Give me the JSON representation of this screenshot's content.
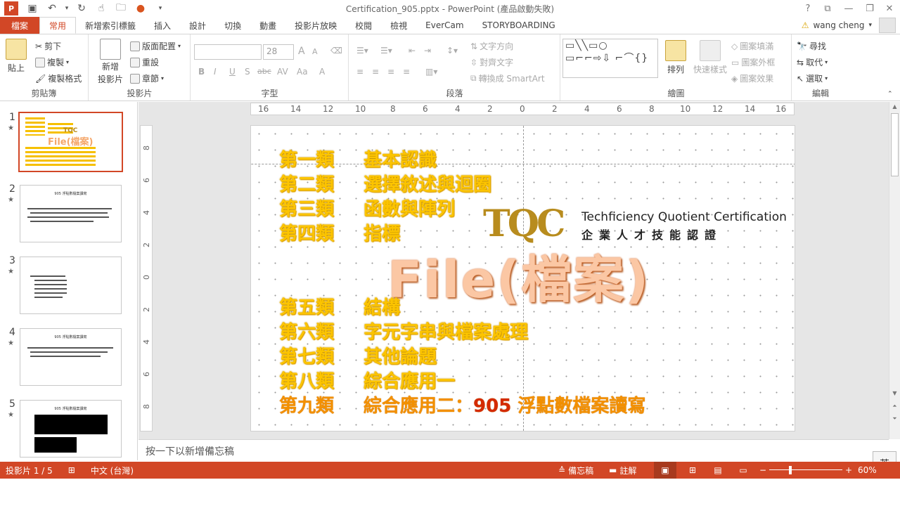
{
  "app": {
    "window_title": "Certification_905.pptx - PowerPoint (產品啟動失敗)",
    "help": "?"
  },
  "tabs": [
    "檔案",
    "常用",
    "新增索引標籤",
    "插入",
    "設計",
    "切換",
    "動畫",
    "投影片放映",
    "校閱",
    "檢視",
    "EverCam",
    "STORYBOARDING"
  ],
  "active_tab": "常用",
  "user": {
    "name": "wang cheng",
    "warning_icon": "warning-icon"
  },
  "ribbon": {
    "clipboard": {
      "paste": "貼上",
      "cut": "剪下",
      "copy": "複製",
      "format_painter": "複製格式",
      "label": "剪貼簿"
    },
    "slides": {
      "new_slide": "新增",
      "new_slide2": "投影片",
      "layout": "版面配置",
      "reset": "重設",
      "section": "章節",
      "label": "投影片"
    },
    "font": {
      "size": "28",
      "label": "字型",
      "bold": "B",
      "italic": "I",
      "underline": "U",
      "shadow": "S",
      "strike": "abc",
      "spacing": "AV",
      "case": "Aa",
      "grow": "A",
      "shrink": "A"
    },
    "paragraph": {
      "text_direction": "文字方向",
      "align_text": "對齊文字",
      "smartart": "轉換成 SmartArt",
      "label": "段落"
    },
    "drawing": {
      "shapes": "▭╲╲▭○ ▭⌐⌐⇨⇩ ⌐⌒{}",
      "arrange": "排列",
      "quick_styles": "快速樣式",
      "fill": "圖案填滿",
      "outline": "圖案外框",
      "effects": "圖案效果",
      "label": "繪圖"
    },
    "editing": {
      "find": "尋找",
      "replace": "取代",
      "select": "選取",
      "label": "編輯"
    }
  },
  "thumbnails": [
    {
      "num": "1",
      "title": ""
    },
    {
      "num": "2",
      "title": "905 浮點數檔案讀寫"
    },
    {
      "num": "3",
      "title": ""
    },
    {
      "num": "4",
      "title": "905 浮點數檔案讀寫"
    },
    {
      "num": "5",
      "title": "905 浮點數檔案讀寫"
    }
  ],
  "ruler": {
    "h": [
      "16",
      "14",
      "12",
      "10",
      "8",
      "6",
      "4",
      "2",
      "0",
      "2",
      "4",
      "6",
      "8",
      "10",
      "12",
      "14",
      "16"
    ],
    "v": [
      "8",
      "6",
      "4",
      "2",
      "0",
      "2",
      "4",
      "6",
      "8"
    ]
  },
  "slide": {
    "categories": [
      {
        "n": "第一類",
        "t": "基本認識"
      },
      {
        "n": "第二類",
        "t": "選擇敘述與迴圈"
      },
      {
        "n": "第三類",
        "t": "函數與陣列"
      },
      {
        "n": "第四類",
        "t": "指標"
      },
      {
        "n": "第五類",
        "t": "結構"
      },
      {
        "n": "第六類",
        "t": "字元字串與檔案處理"
      },
      {
        "n": "第七類",
        "t": "其他論題"
      },
      {
        "n": "第八類",
        "t": "綜合應用一"
      }
    ],
    "last": {
      "n": "第九類",
      "pre": "綜合應用二：",
      "hl": "905",
      "post": " 浮點數檔案讀寫"
    },
    "big_title": "File(檔案)",
    "logo": {
      "mark": "TQC",
      "en": "Techficiency Quotient Certification",
      "zh": "企業人才技能認證"
    }
  },
  "notes_placeholder": "按一下以新增備忘稿",
  "status": {
    "slide": "投影片 1 / 5",
    "lang": "中文 (台灣)",
    "notes": "備忘稿",
    "comments": "註解",
    "zoom": "60%",
    "ime": "英"
  },
  "colors": {
    "accent": "#d24726",
    "category_text": "#fcc400",
    "title_text": "#fbc7a4",
    "logo": "#b88c1e"
  }
}
